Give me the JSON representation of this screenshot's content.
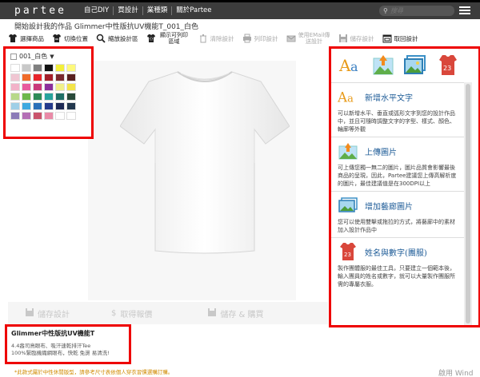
{
  "nav": {
    "logo": "partee",
    "items": [
      "自己DIY",
      "買設計",
      "業種類",
      "關於Partee"
    ],
    "search_placeholder": "搜尋"
  },
  "page": {
    "title": "開始設計我的作品 Glimmer中性版抗UV機能T_001_白色"
  },
  "toolbar": {
    "items": [
      {
        "label": "選擇商品",
        "icon": "tshirt-icon",
        "enabled": true
      },
      {
        "label": "切換位置",
        "icon": "tshirt-switch-icon",
        "enabled": true
      },
      {
        "label": "縮放設計區",
        "icon": "magnifier-icon",
        "enabled": true
      },
      {
        "label": "顯示可列印區域",
        "icon": "tshirt-print-area-icon",
        "enabled": true
      },
      {
        "label": "清除設計",
        "icon": "trash-icon",
        "enabled": false
      },
      {
        "label": "列印設計",
        "icon": "printer-icon",
        "enabled": false
      },
      {
        "label": "使用EMail傳送設計",
        "icon": "email-icon",
        "enabled": false
      },
      {
        "label": "儲存設計",
        "icon": "save-icon",
        "enabled": false
      },
      {
        "label": "取回設計",
        "icon": "folder-icon",
        "enabled": true
      }
    ]
  },
  "color_panel": {
    "selected": "001_白色",
    "colors": [
      "#ffffff",
      "#c8c8c8",
      "#7f7f7f",
      "#111111",
      "#f3ef3a",
      "#fdf97c",
      "#f0c6d2",
      "#f06b2a",
      "#e8262b",
      "#a41f2a",
      "#7a2a2f",
      "#5a2221",
      "#f2b3c9",
      "#e85a9e",
      "#c93a7b",
      "#8c2f9c",
      "#f1f08a",
      "#f3e44a",
      "#b7d98a",
      "#6cb84c",
      "#2e8b57",
      "#27a39d",
      "#1f6f66",
      "#2a4a3a",
      "#9fcfe7",
      "#3fa9e0",
      "#2a6fb8",
      "#253a8c",
      "#1e2a55",
      "#23384e",
      "#8c7bb7",
      "#b46fb5",
      "#c9546c",
      "#e98aa7",
      "#ffffff",
      "#ffffff"
    ]
  },
  "actions": {
    "save": "儲存設計",
    "quote": "取得報價",
    "save_buy": "儲存 & 購買"
  },
  "product": {
    "name": "Glimmer中性版抗UV機能T",
    "desc1": "4.4盎司鳥眼布、吸汗速乾排汗Tee",
    "desc2": "100%緊臨機織網眼布，快乾 免燙 易清洗!",
    "notice": "*此款式屬於中性休閒版型，請參考尺寸表依個人穿衣習慣選購訂購。"
  },
  "right_panel": {
    "tabs": [
      {
        "name": "text-tab",
        "icon": "text-aa-icon"
      },
      {
        "name": "upload-tab",
        "icon": "upload-image-icon"
      },
      {
        "name": "gallery-tab",
        "icon": "gallery-icon"
      },
      {
        "name": "jersey-tab",
        "icon": "jersey-icon"
      }
    ],
    "features": [
      {
        "title": "新增水平文字",
        "desc": "可以新增水平、垂直或弧形文字到您的設計作品中，並且可隨時調整文字的字型、樣式、顏色、輪廓等外觀"
      },
      {
        "title": "上傳圖片",
        "desc": "可上傳您獨一無二的圖片，圖片品質會影響最後商品的呈現，因此，Partee建議您上傳高解析度的圖片，最佳建議值是在300DPI以上"
      },
      {
        "title": "增加藝廊圖片",
        "desc": "您可以使用雙擊或拖拉的方式，將藝廊中的素材加入設計作品中"
      },
      {
        "title": "姓名與數字(團服)",
        "desc": "製作團體服的最佳工具，只要建立一個範本後，輸入團員的姓名或數字，就可以大量製作團服所需的專屬衣服。"
      }
    ]
  },
  "watermark": "啟用 Wind"
}
